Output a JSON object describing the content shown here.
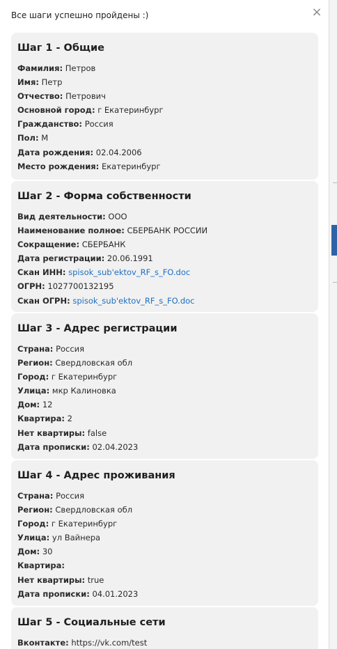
{
  "modal": {
    "header": "Все шаги успешно пройдены :)",
    "close_glyph": "×"
  },
  "steps": [
    {
      "title": "Шаг 1 - Общие",
      "fields": [
        {
          "label": "Фамилия:",
          "value": "Петров"
        },
        {
          "label": "Имя:",
          "value": "Петр"
        },
        {
          "label": "Отчество:",
          "value": "Петрович"
        },
        {
          "label": "Основной город:",
          "value": "г Екатеринбург"
        },
        {
          "label": "Гражданство:",
          "value": "Россия"
        },
        {
          "label": "Пол:",
          "value": "М"
        },
        {
          "label": "Дата рождения:",
          "value": "02.04.2006"
        },
        {
          "label": "Место рождения:",
          "value": "Екатеринбург"
        }
      ]
    },
    {
      "title": "Шаг 2 - Форма собственности",
      "fields": [
        {
          "label": "Вид деятельности:",
          "value": "ООО"
        },
        {
          "label": "Наименование полное:",
          "value": "СБЕРБАНК РОССИИ"
        },
        {
          "label": "Сокращение:",
          "value": "СБЕРБАНК"
        },
        {
          "label": "Дата регистрации:",
          "value": "20.06.1991"
        },
        {
          "label": "Скан ИНН:",
          "value": "spisok_sub'ektov_RF_s_FO.doc",
          "link": true
        },
        {
          "label": "ОГРН:",
          "value": "1027700132195"
        },
        {
          "label": "Скан ОГРН:",
          "value": "spisok_sub'ektov_RF_s_FO.doc",
          "link": true
        }
      ]
    },
    {
      "title": "Шаг 3 - Адрес регистрации",
      "fields": [
        {
          "label": "Страна:",
          "value": "Россия"
        },
        {
          "label": "Регион:",
          "value": "Свердловская обл"
        },
        {
          "label": "Город:",
          "value": "г Екатеринбург"
        },
        {
          "label": "Улица:",
          "value": "мкр Калиновка"
        },
        {
          "label": "Дом:",
          "value": "12"
        },
        {
          "label": "Квартира:",
          "value": "2"
        },
        {
          "label": "Нет квартиры:",
          "value": "false"
        },
        {
          "label": "Дата прописки:",
          "value": "02.04.2023"
        }
      ]
    },
    {
      "title": "Шаг 4 - Адрес проживания",
      "fields": [
        {
          "label": "Страна:",
          "value": "Россия"
        },
        {
          "label": "Регион:",
          "value": "Свердловская обл"
        },
        {
          "label": "Город:",
          "value": "г Екатеринбург"
        },
        {
          "label": "Улица:",
          "value": "ул Вайнера"
        },
        {
          "label": "Дом:",
          "value": "30"
        },
        {
          "label": "Квартира:",
          "value": ""
        },
        {
          "label": "Нет квартиры:",
          "value": "true"
        },
        {
          "label": "Дата прописки:",
          "value": "04.01.2023"
        }
      ]
    },
    {
      "title": "Шаг 5 - Социальные сети",
      "fields": [
        {
          "label": "Вконтакте:",
          "value": "https://vk.com/test"
        }
      ]
    }
  ],
  "colors": {
    "card_bg": "#f1f1f1",
    "link": "#1e6fc1",
    "backdrop_accent": "#2e62a6"
  }
}
